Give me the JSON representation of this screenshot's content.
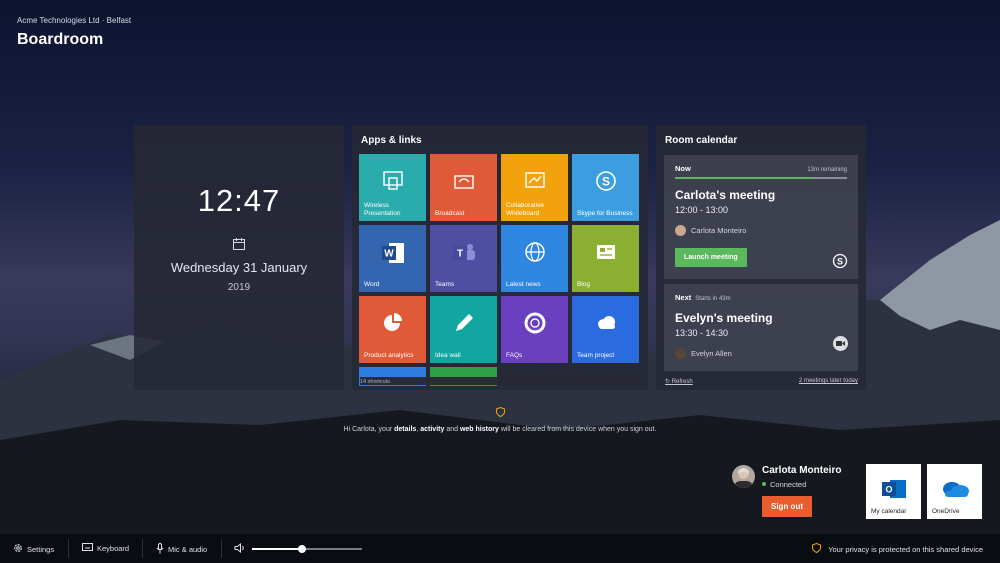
{
  "header": {
    "org": "Acme Technologies Ltd · Belfast",
    "room": "Boardroom"
  },
  "clock": {
    "time": "12:47",
    "date": "Wednesday 31 January",
    "year": "2019"
  },
  "apps": {
    "title": "Apps & links",
    "shortcuts": "14 shortcuts",
    "tiles": [
      {
        "label": "Wireless Presentation",
        "color": "#2aacac",
        "icon": "wireless-presentation-icon"
      },
      {
        "label": "Broadcast",
        "color": "#e05a37",
        "icon": "broadcast-icon"
      },
      {
        "label": "Collaborative Whiteboard",
        "color": "#f2a20c",
        "icon": "whiteboard-icon"
      },
      {
        "label": "Skype for Business",
        "color": "#3c9ee0",
        "icon": "skype-icon"
      },
      {
        "label": "Word",
        "color": "#3465b0",
        "icon": "word-icon"
      },
      {
        "label": "Teams",
        "color": "#4e4fa3",
        "icon": "teams-icon"
      },
      {
        "label": "Latest news",
        "color": "#2f86e0",
        "icon": "globe-icon"
      },
      {
        "label": "Blog",
        "color": "#8bb031",
        "icon": "blog-icon"
      },
      {
        "label": "Product analytics",
        "color": "#e05a37",
        "icon": "pie-chart-icon"
      },
      {
        "label": "Idea wall",
        "color": "#11a6a0",
        "icon": "pencil-icon"
      },
      {
        "label": "FAQs",
        "color": "#6a3fc0",
        "icon": "lifebuoy-icon"
      },
      {
        "label": "Team project",
        "color": "#2a6ce0",
        "icon": "cloud-icon"
      },
      {
        "label": "",
        "color": "#2f7de0",
        "icon": ""
      },
      {
        "label": "",
        "color": "#2f9e44",
        "icon": ""
      }
    ]
  },
  "calendar": {
    "title": "Room calendar",
    "now": {
      "label": "Now",
      "remaining": "13m remaining",
      "progress": 0.8,
      "title": "Carlota's meeting",
      "time": "12:00 - 13:00",
      "organizer": "Carlota Monteiro",
      "launch": "Launch meeting"
    },
    "next": {
      "label": "Next",
      "starts": "Starts in 43m",
      "title": "Evelyn's meeting",
      "time": "13:30 - 14:30",
      "organizer": "Evelyn Allen"
    },
    "refresh": "Refresh",
    "later": "2 meetings later today"
  },
  "notice": {
    "pre": "Hi Carlota, your",
    "details": "details",
    "sep": ",",
    "activity": "activity",
    "and": "and",
    "web": "web history",
    "post": "will be cleared from this device when you sign out."
  },
  "user": {
    "name": "Carlota Monteiro",
    "status": "Connected",
    "signout": "Sign out"
  },
  "quick": [
    {
      "label": "My calendar",
      "icon": "outlook-icon"
    },
    {
      "label": "OneDrive",
      "icon": "onedrive-icon"
    }
  ],
  "bottom": {
    "settings": "Settings",
    "keyboard": "Keyboard",
    "mic": "Mic & audio",
    "volume": 0.45,
    "privacy": "Your privacy is protected on this shared device"
  }
}
